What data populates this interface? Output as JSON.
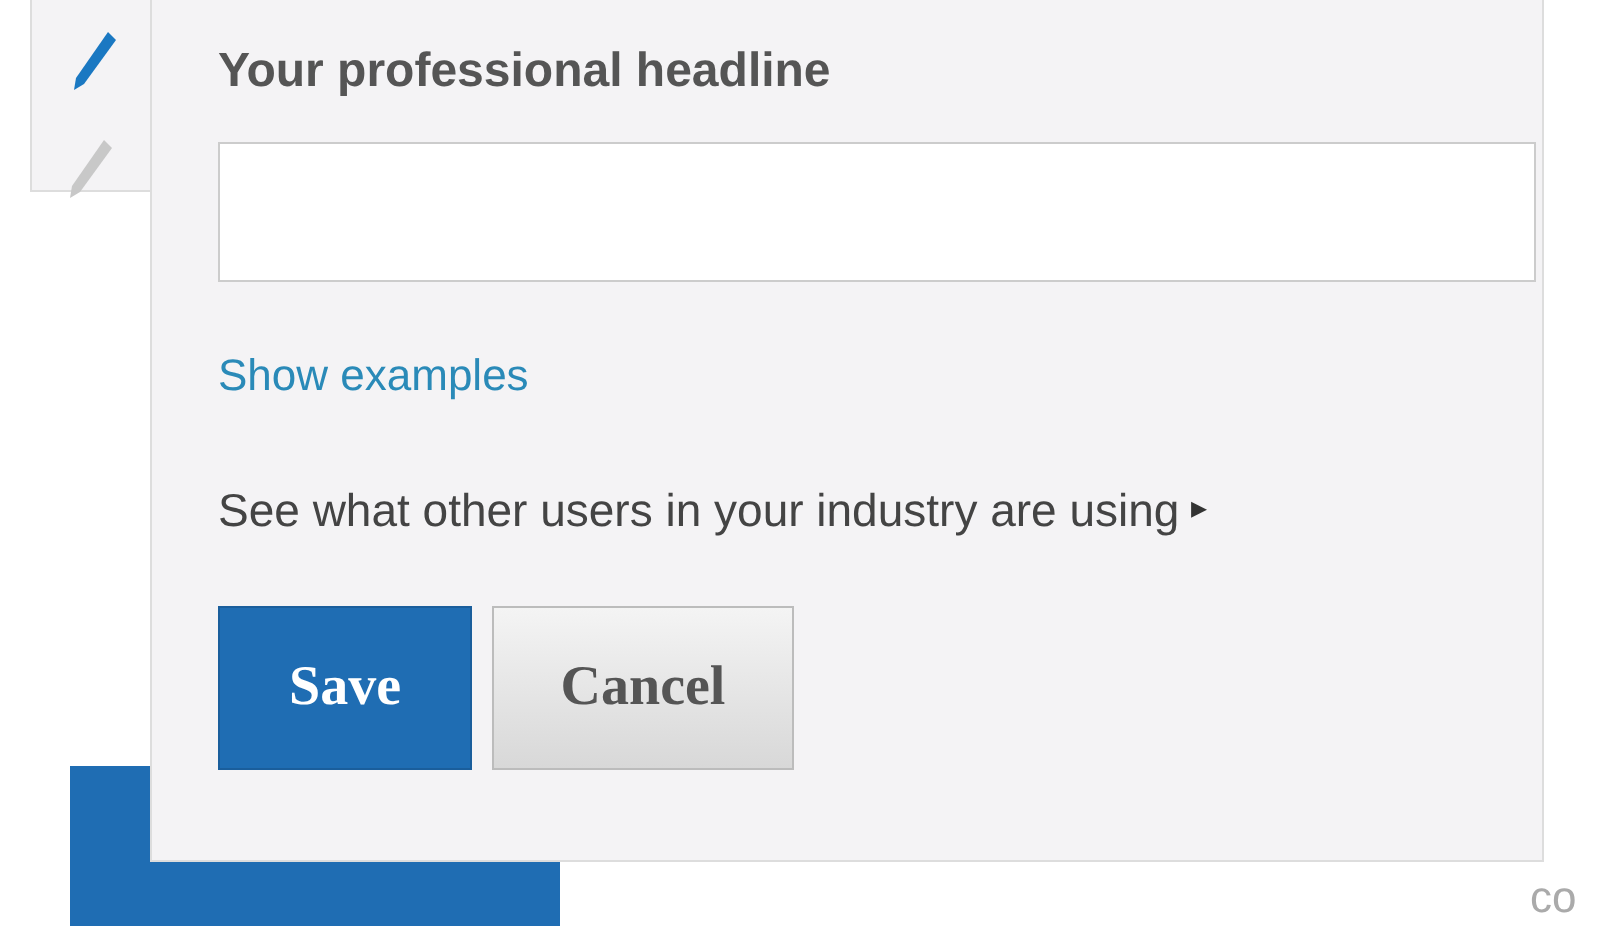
{
  "form": {
    "label": "Your professional headline",
    "link": "Show examples",
    "hint": "See what other users in your industry are using",
    "hint_arrow": "▸",
    "buttons": [
      {
        "label": "Save",
        "kind": "primary"
      },
      {
        "label": "Cancel",
        "kind": "secondary"
      }
    ]
  },
  "background": {
    "corner_text": "co"
  }
}
